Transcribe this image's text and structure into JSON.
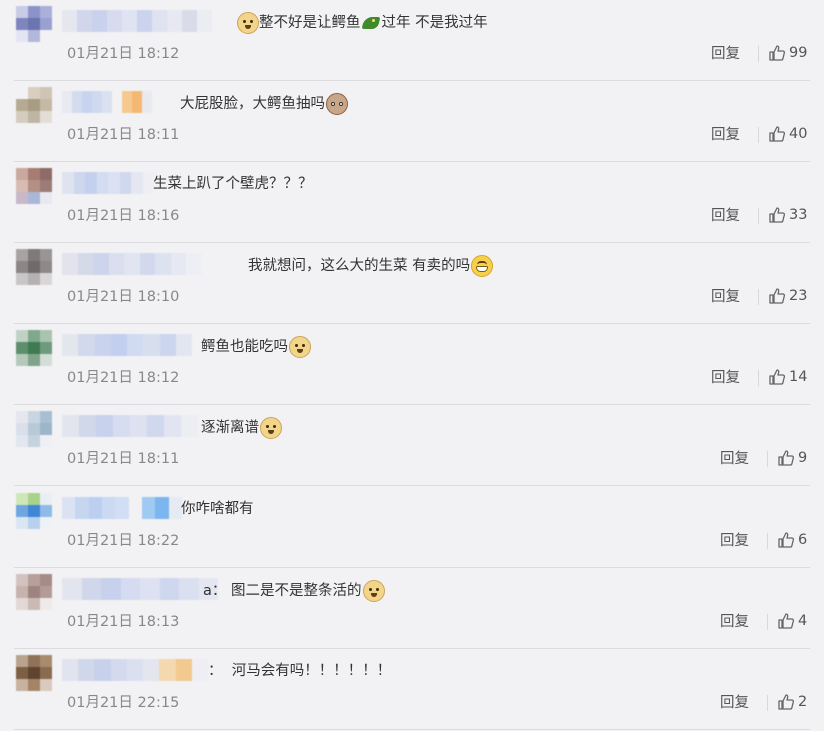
{
  "comments": [
    {
      "avatar_colors": [
        "#c8cce6",
        "#8b93c9",
        "#aab0d9",
        "#7f86bd",
        "#6c74b1",
        "#9aa1d1",
        "#e3e5f3",
        "#b2b7dc",
        "#f2f2f5"
      ],
      "name_colors": [
        "#e6e6ee",
        "#d2d6ea",
        "#c9d2ec",
        "#d6dbef",
        "#e0e3f1",
        "#ccd3ed",
        "#dfe2f0",
        "#e7e8f1",
        "#d9dbe9",
        "#ececf3"
      ],
      "text_left": 236,
      "segments": [
        {
          "type": "emoji",
          "icon": "doge"
        },
        {
          "type": "text",
          "value": "整不好是让鳄鱼"
        },
        {
          "type": "emoji",
          "icon": "croc"
        },
        {
          "type": "text",
          "value": "过年 不是我过年"
        }
      ],
      "time": "01月21日 18:12",
      "reply_label": "回复",
      "likes": "99"
    },
    {
      "avatar_colors": [
        "#f2f2f5",
        "#d8cfc0",
        "#cfc5b4",
        "#b7aa92",
        "#a89c82",
        "#c4b9a4",
        "#d4cdbf",
        "#bfb5a3",
        "#e3ded5"
      ],
      "name_colors": [
        "#e8eaf2",
        "#d3dcef",
        "#c8d4ef",
        "#cfd9f0",
        "#dbe1f1",
        "#f2f2f5",
        "#f7c98e",
        "#f4b873",
        "#e9e9f0"
      ],
      "text_left": 180,
      "segments": [
        {
          "type": "text",
          "value": "大屁股脸，大鳄鱼抽吗"
        },
        {
          "type": "emoji",
          "icon": "cat"
        }
      ],
      "time": "01月21日 18:11",
      "reply_label": "回复",
      "likes": "40"
    },
    {
      "avatar_colors": [
        "#c9a89e",
        "#a77c73",
        "#8e6b66",
        "#d6bcb2",
        "#b38f84",
        "#9b7c78",
        "#c8b8c8",
        "#a9b8d8",
        "#e8e8f0"
      ],
      "name_colors": [
        "#dfe3f0",
        "#cdd7ee",
        "#c4d1ee",
        "#d3dcf0",
        "#dbe1f2",
        "#cfd8ee",
        "#e4e7f2",
        "#eeeef4"
      ],
      "text_left": 153,
      "segments": [
        {
          "type": "text",
          "value": "生菜上趴了个壁虎？？？"
        }
      ],
      "time": "01月21日 18:16",
      "reply_label": "回复",
      "likes": "33"
    },
    {
      "avatar_colors": [
        "#a8a3a3",
        "#7f797a",
        "#9a9495",
        "#8c8687",
        "#6f6a6b",
        "#8e8889",
        "#c9c6c7",
        "#b5b1b2",
        "#d8d6d7"
      ],
      "name_colors": [
        "#e2e3ec",
        "#d5dae9",
        "#cdd5ec",
        "#d9dfef",
        "#e1e4f1",
        "#d2d9ee",
        "#dde2f0",
        "#e6e8f2",
        "#eeeff4"
      ],
      "text_left": 248,
      "segments": [
        {
          "type": "text",
          "value": "我就想问，这么大的生菜 有卖的吗"
        },
        {
          "type": "emoji",
          "icon": "grin"
        }
      ],
      "time": "01月21日 18:10",
      "reply_label": "回复",
      "likes": "23"
    },
    {
      "avatar_colors": [
        "#bfd3c4",
        "#7ea98a",
        "#a9c3b0",
        "#5e8f6d",
        "#3f7a52",
        "#6e9b7b",
        "#b5c9ba",
        "#7fa48b",
        "#d3ded6"
      ],
      "name_colors": [
        "#e4e6ee",
        "#d2d9ec",
        "#c9d3ee",
        "#c3cfee",
        "#d0daf0",
        "#d7dfef",
        "#cbd6ee",
        "#e2e6f1"
      ],
      "text_left": 201,
      "segments": [
        {
          "type": "text",
          "value": "鳄鱼也能吃吗"
        },
        {
          "type": "emoji",
          "icon": "doge"
        }
      ],
      "time": "01月21日 18:12",
      "reply_label": "回复",
      "likes": "14"
    },
    {
      "avatar_colors": [
        "#e6e6ee",
        "#c9d6e2",
        "#a8bfd3",
        "#d9e0e9",
        "#b8c9d8",
        "#9db5c9",
        "#e2e6ee",
        "#c6d2de",
        "#eef0f5"
      ],
      "name_colors": [
        "#e3e5ee",
        "#d1d8ea",
        "#c8d2ec",
        "#d6ddf0",
        "#dde1f0",
        "#d0d8ee",
        "#e2e5f1",
        "#eceef4"
      ],
      "text_left": 201,
      "segments": [
        {
          "type": "text",
          "value": "逐渐离谱"
        },
        {
          "type": "emoji",
          "icon": "doge"
        }
      ],
      "time": "01月21日 18:11",
      "reply_label": "回复",
      "likes": "9"
    },
    {
      "avatar_colors": [
        "#cfe7b8",
        "#a8d38a",
        "#e9eef5",
        "#6fa6df",
        "#3f86d6",
        "#8fbbe7",
        "#dbe6f3",
        "#b7d0ee",
        "#eef2f8"
      ],
      "name_colors": [
        "#dbe3f2",
        "#c6d6f0",
        "#bccff0",
        "#cbd9f2",
        "#d2def3",
        "#f2f2f5",
        "#9fcaf2",
        "#7cb6ee",
        "#e6eaf3"
      ],
      "text_left": 181,
      "segments": [
        {
          "type": "text",
          "value": "你咋啥都有"
        }
      ],
      "time": "01月21日 18:22",
      "reply_label": "回复",
      "likes": "6"
    },
    {
      "avatar_colors": [
        "#d3c3c0",
        "#b89f9b",
        "#a68c88",
        "#c7b2ae",
        "#9e8480",
        "#b49b97",
        "#e3d8d6",
        "#cbb9b6",
        "#efe9e8"
      ],
      "name_colors": [
        "#e2e4ee",
        "#d1d7ea",
        "#c8d1ec",
        "#d5dbf0",
        "#dde1f1",
        "#cfd7ee",
        "#dbe0f0",
        "#e4e7f2"
      ],
      "text_left": 203,
      "segments": [
        {
          "type": "text",
          "value": "a："
        },
        {
          "type": "text",
          "value": " 图二是不是整条活的"
        },
        {
          "type": "emoji",
          "icon": "doge"
        }
      ],
      "time": "01月21日 18:13",
      "reply_label": "回复",
      "likes": "4"
    },
    {
      "avatar_colors": [
        "#b9a38e",
        "#8f7258",
        "#a88a6d",
        "#7d5f44",
        "#5f4530",
        "#8a6b4f",
        "#c6b29f",
        "#a38566",
        "#d8cbbd"
      ],
      "name_colors": [
        "#e1e4ee",
        "#d0d7ea",
        "#c8d1eb",
        "#d3daee",
        "#dbe0f0",
        "#e3e5ef",
        "#f4d8b0",
        "#f2c98f",
        "#eeeef4"
      ],
      "text_left": 208,
      "segments": [
        {
          "type": "text",
          "value": "：  河马会有吗！！！！！！"
        }
      ],
      "time": "01月21日 22:15",
      "reply_label": "回复",
      "likes": "2"
    }
  ]
}
